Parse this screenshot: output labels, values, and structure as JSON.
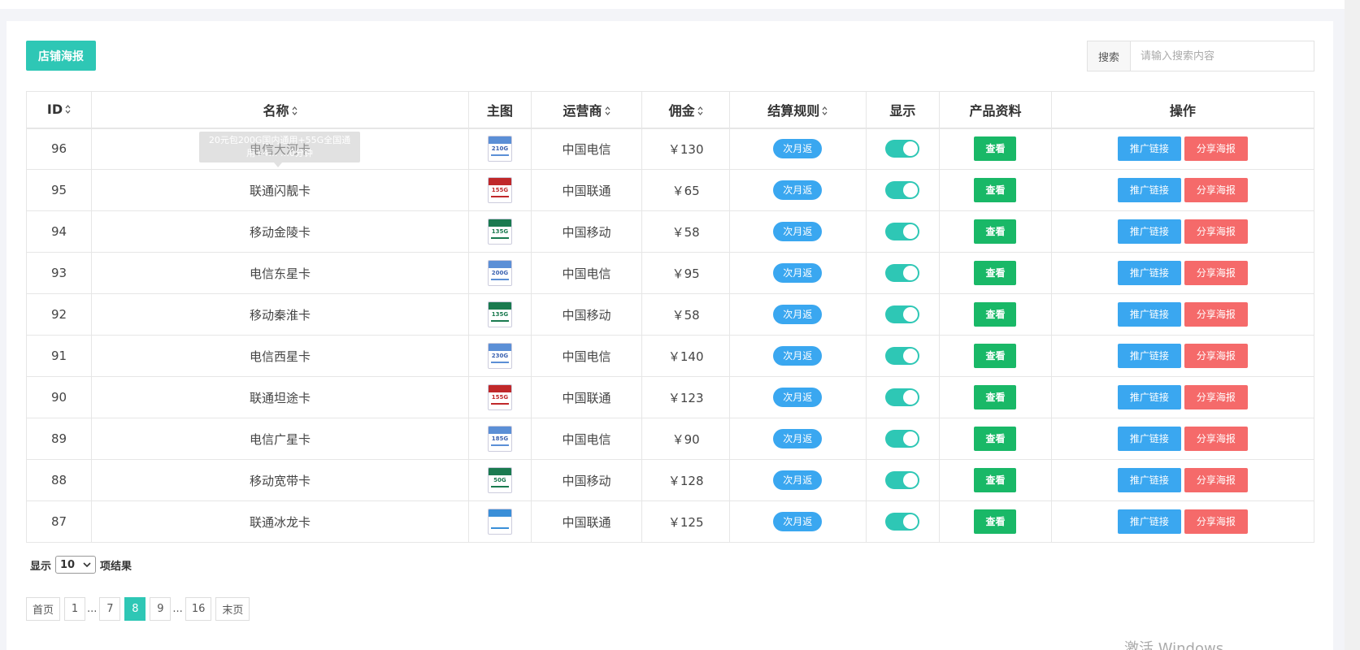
{
  "toolbar": {
    "poster_label": "店铺海报",
    "search_label": "搜索",
    "search_placeholder": "请输入搜索内容"
  },
  "columns": [
    "ID",
    "名称",
    "主图",
    "运营商",
    "佣金",
    "结算规则",
    "显示",
    "产品资料",
    "操作"
  ],
  "sortable": [
    true,
    true,
    false,
    true,
    true,
    true,
    false,
    false,
    false
  ],
  "rows": [
    {
      "id": "96",
      "name": "电信大河卡",
      "carrier": "中国电信",
      "commission": "￥130",
      "rule": "次月返",
      "view": "查看",
      "link": "推广链接",
      "share": "分享海报",
      "thumb": {
        "band": "#5b8fd6",
        "text": "210G",
        "text_color": "#3b62b0"
      }
    },
    {
      "id": "95",
      "name": "联通闪靓卡",
      "carrier": "中国联通",
      "commission": "￥65",
      "rule": "次月返",
      "view": "查看",
      "link": "推广链接",
      "share": "分享海报",
      "thumb": {
        "band": "#c0282a",
        "text": "155G",
        "text_color": "#c0282a"
      }
    },
    {
      "id": "94",
      "name": "移动金陵卡",
      "carrier": "中国移动",
      "commission": "￥58",
      "rule": "次月返",
      "view": "查看",
      "link": "推广链接",
      "share": "分享海报",
      "thumb": {
        "band": "#1a7a4f",
        "text": "135G",
        "text_color": "#1a7a4f"
      }
    },
    {
      "id": "93",
      "name": "电信东星卡",
      "carrier": "中国电信",
      "commission": "￥95",
      "rule": "次月返",
      "view": "查看",
      "link": "推广链接",
      "share": "分享海报",
      "thumb": {
        "band": "#5b8fd6",
        "text": "200G",
        "text_color": "#3b62b0"
      }
    },
    {
      "id": "92",
      "name": "移动秦淮卡",
      "carrier": "中国移动",
      "commission": "￥58",
      "rule": "次月返",
      "view": "查看",
      "link": "推广链接",
      "share": "分享海报",
      "thumb": {
        "band": "#1a7a4f",
        "text": "135G",
        "text_color": "#1a7a4f"
      }
    },
    {
      "id": "91",
      "name": "电信西星卡",
      "carrier": "中国电信",
      "commission": "￥140",
      "rule": "次月返",
      "view": "查看",
      "link": "推广链接",
      "share": "分享海报",
      "thumb": {
        "band": "#5b8fd6",
        "text": "230G",
        "text_color": "#3b62b0"
      }
    },
    {
      "id": "90",
      "name": "联通坦途卡",
      "carrier": "中国联通",
      "commission": "￥123",
      "rule": "次月返",
      "view": "查看",
      "link": "推广链接",
      "share": "分享海报",
      "thumb": {
        "band": "#c0282a",
        "text": "155G",
        "text_color": "#c0282a"
      }
    },
    {
      "id": "89",
      "name": "电信广星卡",
      "carrier": "中国电信",
      "commission": "￥90",
      "rule": "次月返",
      "view": "查看",
      "link": "推广链接",
      "share": "分享海报",
      "thumb": {
        "band": "#5b8fd6",
        "text": "185G",
        "text_color": "#3b62b0"
      }
    },
    {
      "id": "88",
      "name": "移动宽带卡",
      "carrier": "中国移动",
      "commission": "￥128",
      "rule": "次月返",
      "view": "查看",
      "link": "推广链接",
      "share": "分享海报",
      "thumb": {
        "band": "#1a7a4f",
        "text": "50G",
        "text_color": "#1a7a4f"
      }
    },
    {
      "id": "87",
      "name": "联通冰龙卡",
      "carrier": "中国联通",
      "commission": "￥125",
      "rule": "次月返",
      "view": "查看",
      "link": "推广链接",
      "share": "分享海报",
      "thumb": {
        "band": "#3a8fd8",
        "text": "",
        "text_color": "#e04040"
      }
    }
  ],
  "tooltip": {
    "line1": "20元包200G国内通用+55G全国通",
    "line2": "用+4… …0分钟"
  },
  "page_size": {
    "prefix": "显示",
    "value": "10",
    "suffix": "项结果"
  },
  "pagination": [
    {
      "label": "首页",
      "active": false
    },
    {
      "label": "1",
      "active": false
    },
    {
      "label": "...",
      "ellipsis": true
    },
    {
      "label": "7",
      "active": false
    },
    {
      "label": "8",
      "active": true
    },
    {
      "label": "9",
      "active": false
    },
    {
      "label": "...",
      "ellipsis": true
    },
    {
      "label": "16",
      "active": false
    },
    {
      "label": "末页",
      "active": false
    }
  ],
  "watermark": "激活 Windows",
  "colors": {
    "accent": "#2ec7b5",
    "blue": "#3aa7f0",
    "green": "#19b867",
    "red": "#f56a6a"
  }
}
